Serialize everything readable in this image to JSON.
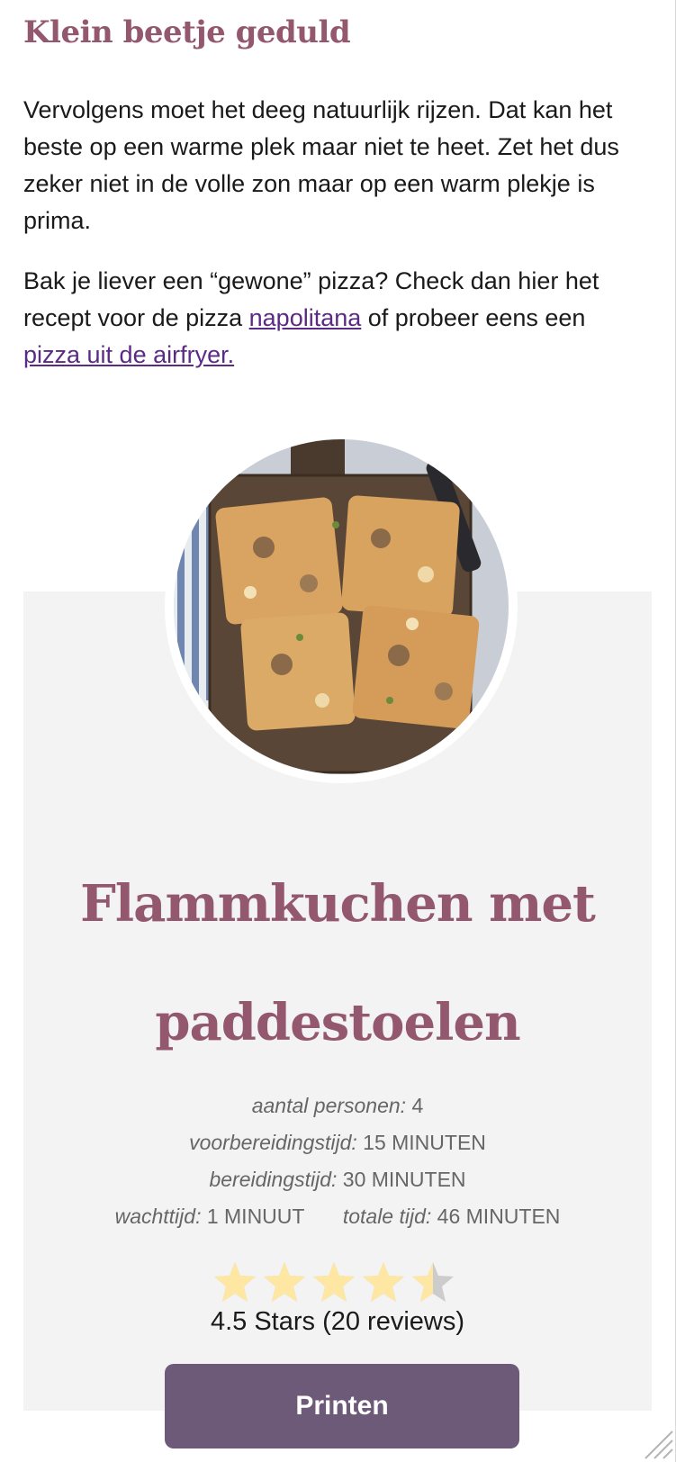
{
  "article": {
    "heading": "Klein beetje geduld",
    "paragraph1": "Vervolgens moet het deeg natuurlijk rijzen. Dat kan het beste op een warme plek maar niet te heet. Zet het dus zeker niet in de volle zon maar op een warm plekje is prima.",
    "paragraph2_part1": "Bak je liever een “gewone” pizza? Check dan hier het recept voor de pizza ",
    "paragraph2_link1": "napolitana",
    "paragraph2_part2": " of probeer eens een ",
    "paragraph2_link2": "pizza uit de airfryer."
  },
  "recipe": {
    "title": "Flammkuchen met paddestoelen",
    "servings_label": "aantal personen:",
    "servings_value": "4",
    "prep_label": "voorbereidingstijd:",
    "prep_value": "15 MINUTEN",
    "cook_label": "bereidingstijd:",
    "cook_value": "30 MINUTEN",
    "wait_label": "wachttijd:",
    "wait_value": "1 MINUUT",
    "total_label": "totale tijd:",
    "total_value": "46 MINUTEN",
    "rating_value": 4.5,
    "rating_max": 5,
    "rating_text": "4.5 Stars (20 reviews)",
    "print_label": "Printen"
  },
  "colors": {
    "heading": "#93586e",
    "link": "#5b2a86",
    "card_background": "#f3f3f3",
    "button": "#6d5a78",
    "star_filled": "#fde7a3",
    "star_empty": "#cccccc"
  }
}
